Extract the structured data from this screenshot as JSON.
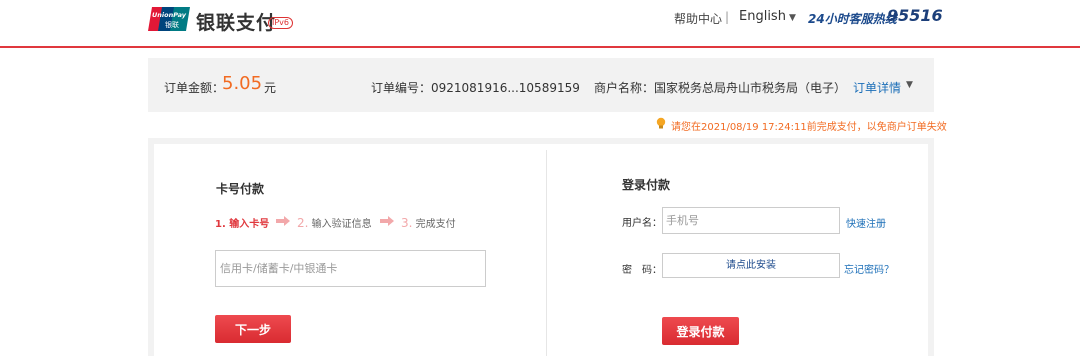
{
  "header": {
    "logo_text_top": "UnionPay",
    "logo_text_bottom": "银联",
    "brand": "银联支付",
    "ipv6_badge": "IPv6",
    "help": "帮助中心",
    "separator": "|",
    "language": "English",
    "hotline_label": "24小时客服热线",
    "hotline_number": "95516"
  },
  "order": {
    "amount_label": "订单金额：",
    "amount_value": "5.05",
    "amount_unit": "元",
    "order_no": "订单编号：0921081916...10589159",
    "merchant": "商户名称：国家税务总局舟山市税务局（电子）",
    "detail_link": "订单详情"
  },
  "notice": "请您在2021/08/19 17:24:11前完成支付，以免商户订单失效",
  "card_pay": {
    "title": "卡号付款",
    "steps": [
      {
        "num": "1.",
        "label": "输入卡号"
      },
      {
        "num": "2.",
        "label": "输入验证信息"
      },
      {
        "num": "3.",
        "label": "完成支付"
      }
    ],
    "card_placeholder": "信用卡/储蓄卡/中银通卡",
    "next_button": "下一步"
  },
  "login_pay": {
    "title": "登录付款",
    "username_label": "用户名：",
    "phone_placeholder": "手机号",
    "register_link": "快速注册",
    "password_label": "密　码：",
    "install_prompt": "请点此安装",
    "forgot_link": "忘记密码？",
    "login_button": "登录付款"
  },
  "colors": {
    "brand_red": "#e0383e",
    "amount_orange": "#f26b22",
    "link_blue": "#1c6fb8",
    "hotline_blue": "#1c3f7a"
  }
}
